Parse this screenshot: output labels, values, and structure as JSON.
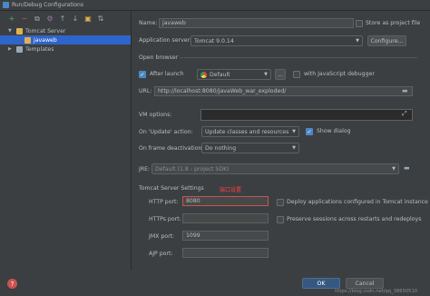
{
  "window": {
    "title": "Run/Debug Configurations"
  },
  "toolbar": {
    "add": "+",
    "remove": "−",
    "copy": "⧉",
    "settings": "⚙",
    "up": "↑",
    "down": "↓",
    "folder": "▣",
    "sort": "⇅"
  },
  "tree": {
    "items": [
      {
        "label": "Tomcat Server",
        "expanded": true
      },
      {
        "label": "javaweb",
        "selected": true
      },
      {
        "label": "Templates",
        "expanded": false
      }
    ]
  },
  "form": {
    "name_label": "Name:",
    "name_value": "javaweb",
    "store_label": "Store as project file",
    "app_server_label": "Application server:",
    "app_server_value": "Tomcat 9.0.14",
    "configure_label": "Configure...",
    "open_browser_label": "Open browser",
    "after_launch_label": "After launch",
    "browser_value": "Default",
    "more_label": "...",
    "js_debugger_label": "with JavaScript debugger",
    "url_label": "URL:",
    "url_value": "http://localhost:8080/JavaWeb_war_exploded/",
    "vm_options_label": "VM options:",
    "vm_options_value": "",
    "on_update_label": "On 'Update' action:",
    "on_update_value": "Update classes and resources",
    "show_dialog_label": "Show dialog",
    "on_frame_label": "On frame deactivation:",
    "on_frame_value": "Do nothing",
    "jre_label": "JRE:",
    "jre_value": "Default (1.8 - project SDK)",
    "tomcat_settings_label": "Tomcat Server Settings",
    "http_port_label": "HTTP port:",
    "http_port_value": "8080",
    "https_port_label": "HTTPs port:",
    "https_port_value": "",
    "jmx_port_label": "JMX port:",
    "jmx_port_value": "1099",
    "ajp_port_label": "AJP port:",
    "ajp_port_value": "",
    "deploy_label": "Deploy applications configured in Tomcat instance",
    "preserve_label": "Preserve sessions across restarts and redeploys",
    "annotation": "端口设置"
  },
  "footer": {
    "ok": "OK",
    "cancel": "Cancel",
    "help": "?",
    "watermark": "https://blog.csdn.net/qq_38650510"
  }
}
